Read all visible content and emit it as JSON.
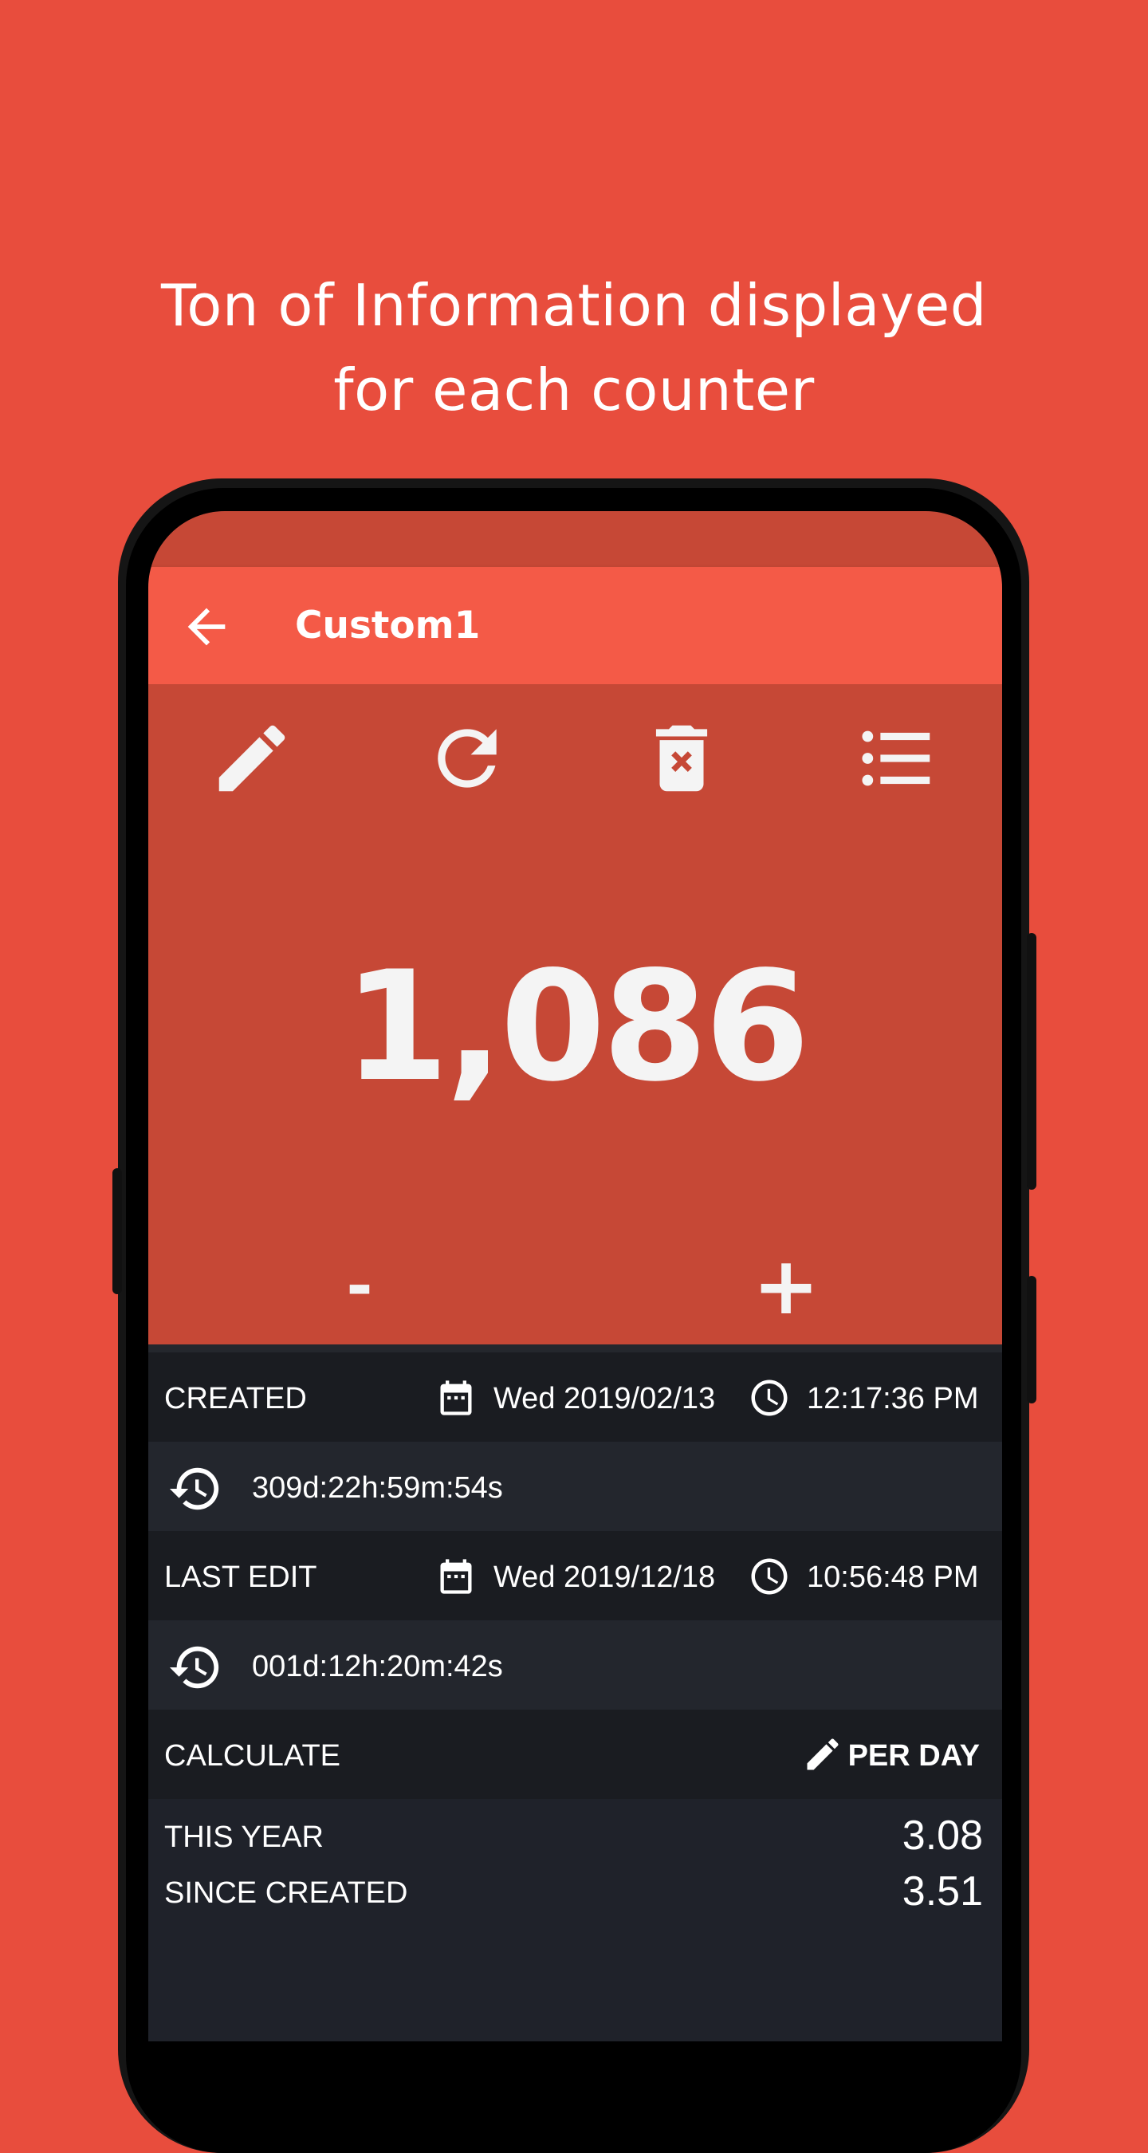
{
  "promo": {
    "line1": "Ton of Information displayed",
    "line2": "for each counter"
  },
  "colors": {
    "background": "#E84D3D",
    "appbar": "#F45A47",
    "counter_area": "#C64836",
    "info_panel": "#1F222A"
  },
  "appbar": {
    "back_icon": "arrow-left-icon",
    "title": "Custom1"
  },
  "toolbar": {
    "icons": [
      "pencil-icon",
      "refresh-icon",
      "delete-icon",
      "list-icon"
    ]
  },
  "counter": {
    "value": "1,086",
    "decrement_label": "-",
    "increment_label": "+"
  },
  "info": {
    "created": {
      "label": "CREATED",
      "date": "Wed 2019/02/13",
      "time": "12:17:36 PM",
      "elapsed": "309d:22h:59m:54s"
    },
    "last_edit": {
      "label": "LAST EDIT",
      "date": "Wed 2019/12/18",
      "time": "10:56:48 PM",
      "elapsed": "001d:12h:20m:42s"
    },
    "calculate": {
      "label": "CALCULATE",
      "mode": "PER DAY"
    },
    "stats": [
      {
        "label": "THIS YEAR",
        "value": "3.08"
      },
      {
        "label": "SINCE CREATED",
        "value": "3.51"
      }
    ]
  }
}
